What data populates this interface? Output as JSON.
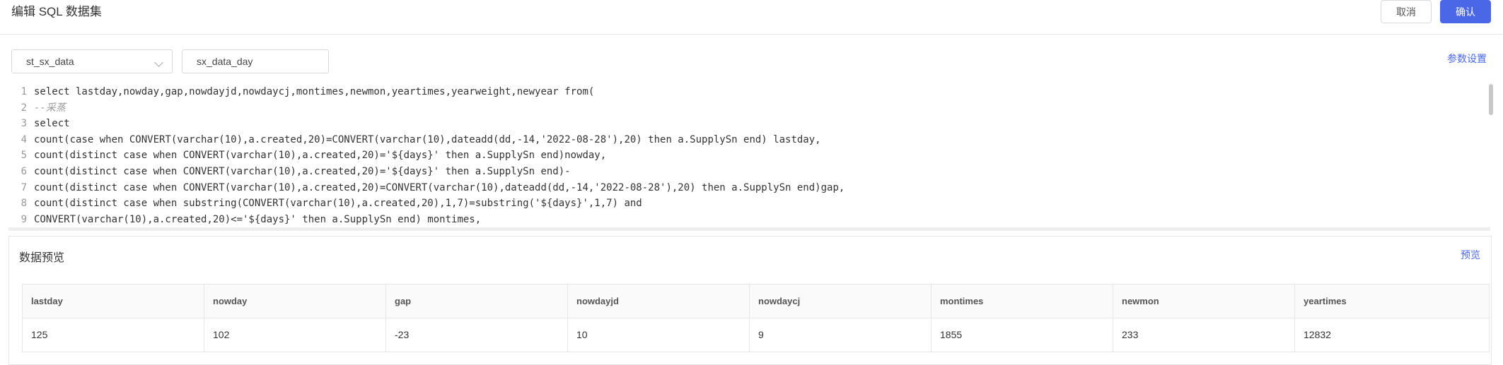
{
  "header": {
    "title": "编辑 SQL 数据集",
    "cancel_label": "取消",
    "confirm_label": "确认"
  },
  "toolbar": {
    "datasource_select": "st_sx_data",
    "dataset_name": "sx_data_day",
    "param_settings_label": "参数设置"
  },
  "editor": {
    "line_numbers": [
      "1",
      "2",
      "3",
      "4",
      "5",
      "6",
      "7",
      "8",
      "9"
    ],
    "lines": [
      "select lastday,nowday,gap,nowdayjd,nowdaycj,montimes,newmon,yeartimes,yearweight,newyear from(",
      "--采蒸",
      "select",
      "count(case when CONVERT(varchar(10),a.created,20)=CONVERT(varchar(10),dateadd(dd,-14,'2022-08-28'),20) then a.SupplySn end) lastday,",
      "count(distinct case when CONVERT(varchar(10),a.created,20)='${days}' then a.SupplySn end)nowday,",
      "count(distinct case when CONVERT(varchar(10),a.created,20)='${days}' then a.SupplySn end)-",
      "count(distinct case when CONVERT(varchar(10),a.created,20)=CONVERT(varchar(10),dateadd(dd,-14,'2022-08-28'),20) then a.SupplySn end)gap,",
      "count(distinct case when substring(CONVERT(varchar(10),a.created,20),1,7)=substring('${days}',1,7) and",
      "CONVERT(varchar(10),a.created,20)<='${days}' then a.SupplySn end) montimes,"
    ]
  },
  "preview": {
    "title": "数据预览",
    "preview_link": "预览",
    "columns": [
      "lastday",
      "nowday",
      "gap",
      "nowdayjd",
      "nowdaycj",
      "montimes",
      "newmon",
      "yeartimes"
    ],
    "rows": [
      [
        "125",
        "102",
        "-23",
        "10",
        "9",
        "1855",
        "233",
        "12832"
      ]
    ]
  }
}
